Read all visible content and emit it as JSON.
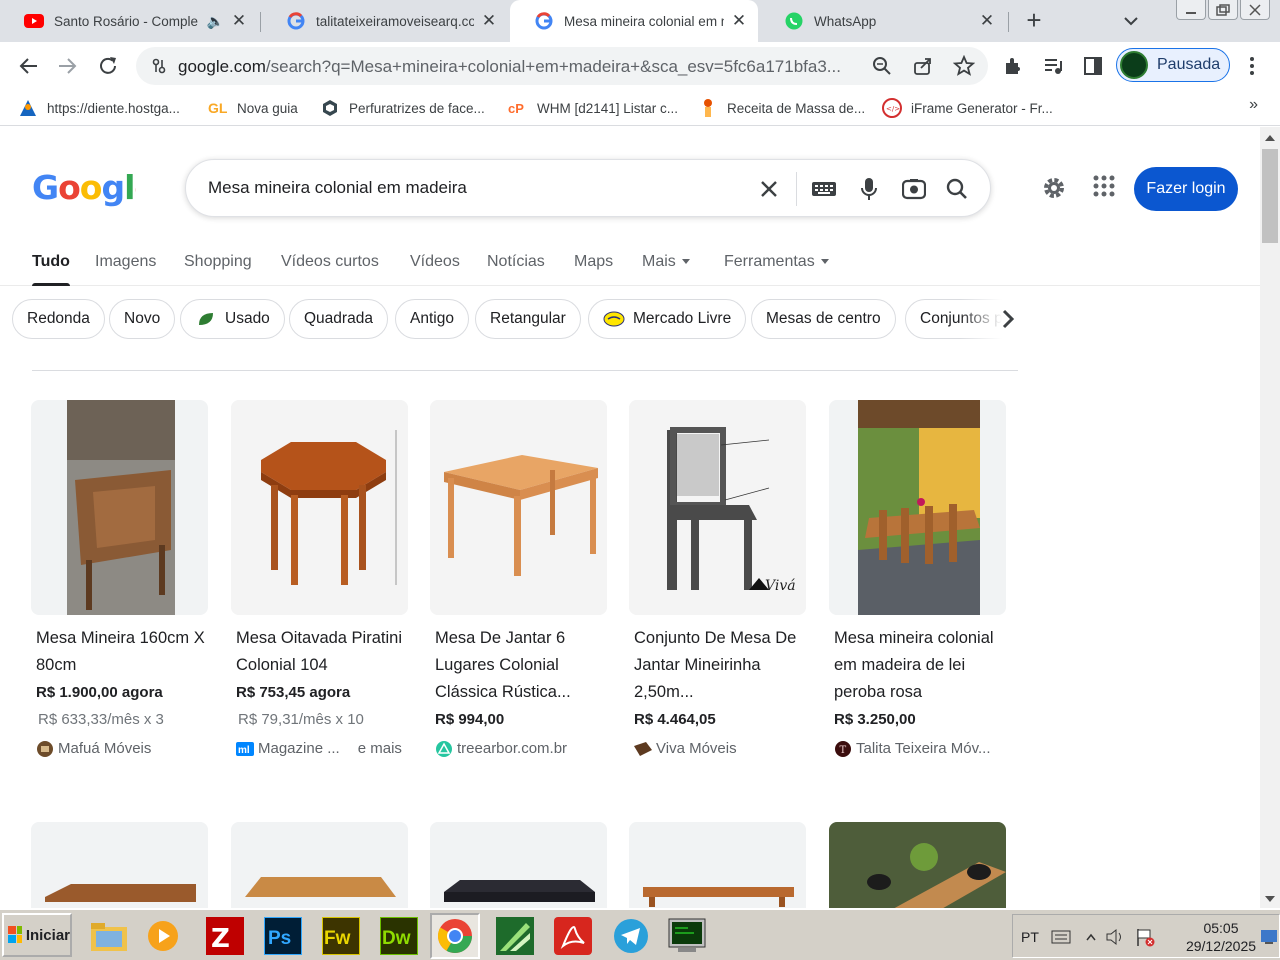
{
  "browser": {
    "tabs": [
      {
        "title": "Santo Rosário - Comple",
        "icon": "youtube-icon",
        "audio": true
      },
      {
        "title": "talitateixeiramoveisearq.com",
        "icon": "google-g-icon"
      },
      {
        "title": "Mesa mineira colonial em ma",
        "icon": "google-g-icon",
        "active": true
      },
      {
        "title": "WhatsApp",
        "icon": "whatsapp-icon"
      }
    ],
    "url_host": "google.com",
    "url_rest": "/search?q=Mesa+mineira+colonial+em+madeira+&sca_esv=5fc6a171bfa3...",
    "profile_label": "Pausada"
  },
  "bookmarks": [
    {
      "label": "https://diente.hostga...",
      "icon": "person-icon"
    },
    {
      "label": "Nova guia",
      "icon": "gl-icon"
    },
    {
      "label": "Perfuratrizes de face...",
      "icon": "hex-icon"
    },
    {
      "label": "WHM [d2141] Listar c...",
      "icon": "cpanel-icon"
    },
    {
      "label": "Receita de Massa de...",
      "icon": "chef-icon"
    },
    {
      "label": "iFrame Generator - Fr...",
      "icon": "iframe-icon"
    }
  ],
  "google": {
    "logo": "Google",
    "query": "Mesa mineira colonial em madeira",
    "login_label": "Fazer login",
    "tabs": [
      "Tudo",
      "Imagens",
      "Shopping",
      "Vídeos curtos",
      "Vídeos",
      "Notícias",
      "Maps",
      "Mais",
      "Ferramentas"
    ],
    "chips": [
      "Redonda",
      "Novo",
      "Usado",
      "Quadrada",
      "Antigo",
      "Retangular",
      "Mercado Livre",
      "Mesas de centro",
      "Conjuntos p"
    ],
    "products": [
      {
        "title": "Mesa Mineira 160cm X 80cm",
        "price": "R$ 1.900,00 agora",
        "installment": "R$ 633,33/mês x 3",
        "store": "Mafuá Móveis",
        "extra": ""
      },
      {
        "title": "Mesa Oitavada Piratini Colonial 104",
        "price": "R$ 753,45 agora",
        "installment": "R$ 79,31/mês x 10",
        "store": "Magazine ...",
        "extra": "e mais"
      },
      {
        "title": "Mesa De Jantar 6 Lugares Colonial Clássica Rústica...",
        "price": "R$ 994,00",
        "installment": "",
        "store": "treearbor.com.br",
        "extra": ""
      },
      {
        "title": "Conjunto De Mesa De Jantar Mineirinha 2,50m...",
        "price": "R$ 4.464,05",
        "installment": "",
        "store": "Viva Móveis",
        "extra": ""
      },
      {
        "title": "Mesa mineira colonial em madeira de lei peroba rosa",
        "price": "R$ 3.250,00",
        "installment": "",
        "store": "Talita Teixeira Móv...",
        "extra": ""
      }
    ]
  },
  "taskbar": {
    "start_label": "Iniciar",
    "lang": "PT",
    "time": "05:05",
    "date": "29/12/2025"
  }
}
